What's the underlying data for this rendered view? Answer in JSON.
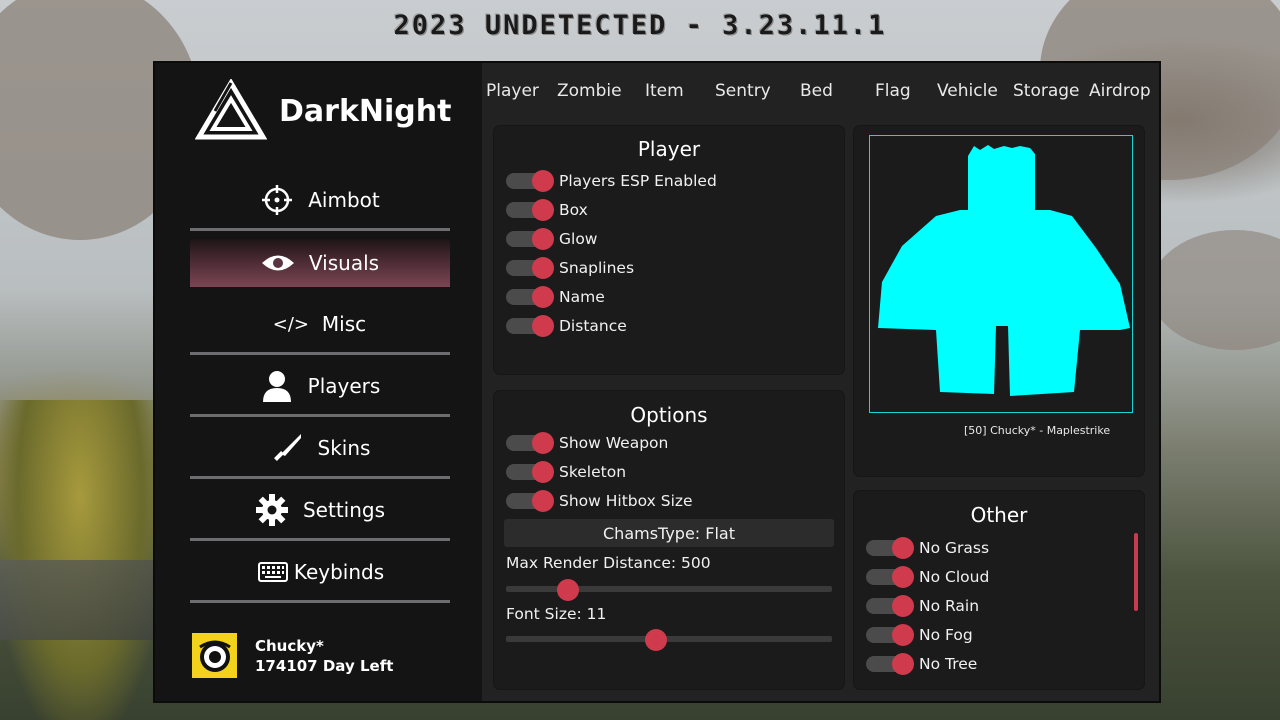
{
  "banner_title": "2023 UNDETECTED - 3.23.11.1",
  "brand": {
    "name": "DarkNight"
  },
  "nav": [
    {
      "label": "Aimbot",
      "icon": "crosshair-icon",
      "active": false
    },
    {
      "label": "Visuals",
      "icon": "eye-icon",
      "active": true
    },
    {
      "label": "Misc",
      "icon": "code-icon",
      "active": false
    },
    {
      "label": "Players",
      "icon": "user-icon",
      "active": false
    },
    {
      "label": "Skins",
      "icon": "knife-icon",
      "active": false
    },
    {
      "label": "Settings",
      "icon": "gear-icon",
      "active": false
    },
    {
      "label": "Keybinds",
      "icon": "keyboard-icon",
      "active": false
    }
  ],
  "user": {
    "name": "Chucky*",
    "subscription": "174107 Day Left"
  },
  "tabs": [
    "Player",
    "Zombie",
    "Item",
    "Sentry",
    "Bed",
    "Flag",
    "Vehicle",
    "Storage",
    "Airdrop"
  ],
  "player_panel": {
    "title": "Player",
    "toggles": [
      {
        "label": "Players ESP Enabled",
        "on": true
      },
      {
        "label": "Box",
        "on": true
      },
      {
        "label": "Glow",
        "on": true
      },
      {
        "label": "Snaplines",
        "on": true
      },
      {
        "label": "Name",
        "on": true
      },
      {
        "label": "Distance",
        "on": true
      }
    ]
  },
  "options_panel": {
    "title": "Options",
    "toggles": [
      {
        "label": "Show Weapon",
        "on": true
      },
      {
        "label": "Skeleton",
        "on": true
      },
      {
        "label": "Show Hitbox Size",
        "on": true
      }
    ],
    "chams_dropdown": "ChamsType: Flat",
    "sliders": [
      {
        "label": "Max Render Distance: 500",
        "fraction": 0.19
      },
      {
        "label": "Font Size: 11",
        "fraction": 0.46
      }
    ]
  },
  "preview_panel": {
    "caption": "[50] Chucky* - Maplestrike",
    "glow_color": "#00ffff"
  },
  "other_panel": {
    "title": "Other",
    "toggles": [
      {
        "label": "No Grass",
        "on": true
      },
      {
        "label": "No Cloud",
        "on": true
      },
      {
        "label": "No Rain",
        "on": true
      },
      {
        "label": "No Fog",
        "on": true
      },
      {
        "label": "No Tree",
        "on": true
      }
    ]
  },
  "colors": {
    "accent": "#cf3a4d",
    "preview": "#19d6d6"
  }
}
